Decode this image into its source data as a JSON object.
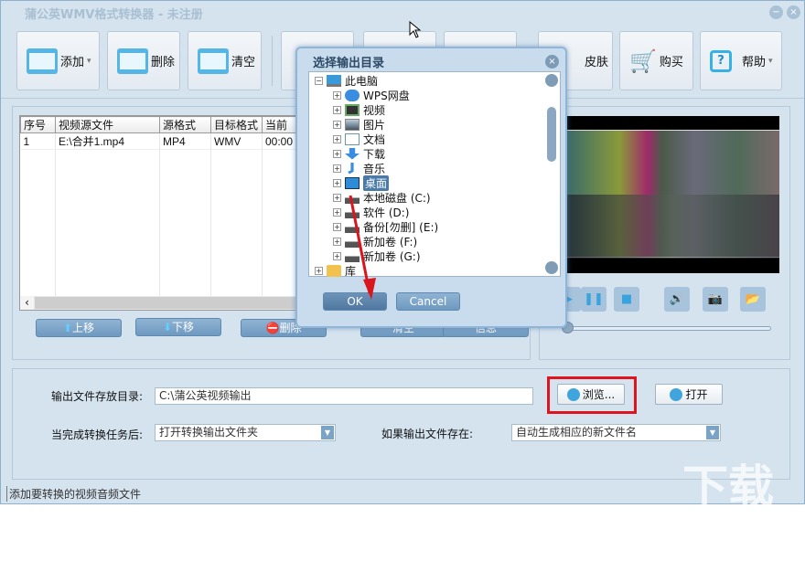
{
  "window": {
    "title": "蒲公英WMV格式转换器 - 未注册",
    "minimize": "−",
    "close": "×"
  },
  "toolbar": {
    "add": "添加",
    "delete": "删除",
    "clear": "清空",
    "skin": "皮肤",
    "buy": "购买",
    "help": "帮助",
    "dropdown": "▾"
  },
  "table": {
    "headers": [
      "序号",
      "视频源文件",
      "源格式",
      "目标格式",
      "当前"
    ],
    "rows": [
      [
        "1",
        "E:\\合并1.mp4",
        "MP4",
        "WMV",
        "00:00"
      ]
    ],
    "scroll_left": "‹"
  },
  "list_buttons": {
    "up": "上移",
    "down": "下移",
    "delete": "删除",
    "b4": "清空",
    "b5": "信息"
  },
  "player": {
    "icons": [
      "play",
      "pause",
      "stop",
      "volume",
      "camera",
      "folder"
    ]
  },
  "output": {
    "dir_label": "输出文件存放目录:",
    "dir_value": "C:\\蒲公英视频输出",
    "browse": "浏览...",
    "open": "打开",
    "after_label": "当完成转换任务后:",
    "after_value": "打开转换输出文件夹",
    "exists_label": "如果输出文件存在:",
    "exists_value": "自动生成相应的新文件名"
  },
  "status": "添加要转换的视频音频文件",
  "dialog": {
    "title": "选择输出目录",
    "close": "×",
    "ok": "OK",
    "cancel": "Cancel",
    "tree": [
      {
        "label": "此电脑",
        "sign": "−",
        "level": 0,
        "icon": "monitor"
      },
      {
        "label": "WPS网盘",
        "sign": "+",
        "level": 1,
        "icon": "cloud"
      },
      {
        "label": "视频",
        "sign": "+",
        "level": 1,
        "icon": "film"
      },
      {
        "label": "图片",
        "sign": "+",
        "level": 1,
        "icon": "image"
      },
      {
        "label": "文档",
        "sign": "+",
        "level": 1,
        "icon": "document"
      },
      {
        "label": "下载",
        "sign": "+",
        "level": 1,
        "icon": "download"
      },
      {
        "label": "音乐",
        "sign": "+",
        "level": 1,
        "icon": "music"
      },
      {
        "label": "桌面",
        "sign": "+",
        "level": 1,
        "icon": "desktop",
        "selected": true
      },
      {
        "label": "本地磁盘 (C:)",
        "sign": "+",
        "level": 1,
        "icon": "drive"
      },
      {
        "label": "软件 (D:)",
        "sign": "+",
        "level": 1,
        "icon": "drive"
      },
      {
        "label": "备份[勿删] (E:)",
        "sign": "+",
        "level": 1,
        "icon": "drive"
      },
      {
        "label": "新加卷 (F:)",
        "sign": "+",
        "level": 1,
        "icon": "drive"
      },
      {
        "label": "新加卷 (G:)",
        "sign": "+",
        "level": 1,
        "icon": "drive"
      },
      {
        "label": "库",
        "sign": "+",
        "level": 0,
        "icon": "folder"
      }
    ]
  },
  "colors": {
    "accent": "#3fa5dc",
    "highlight": "#e0141e"
  }
}
